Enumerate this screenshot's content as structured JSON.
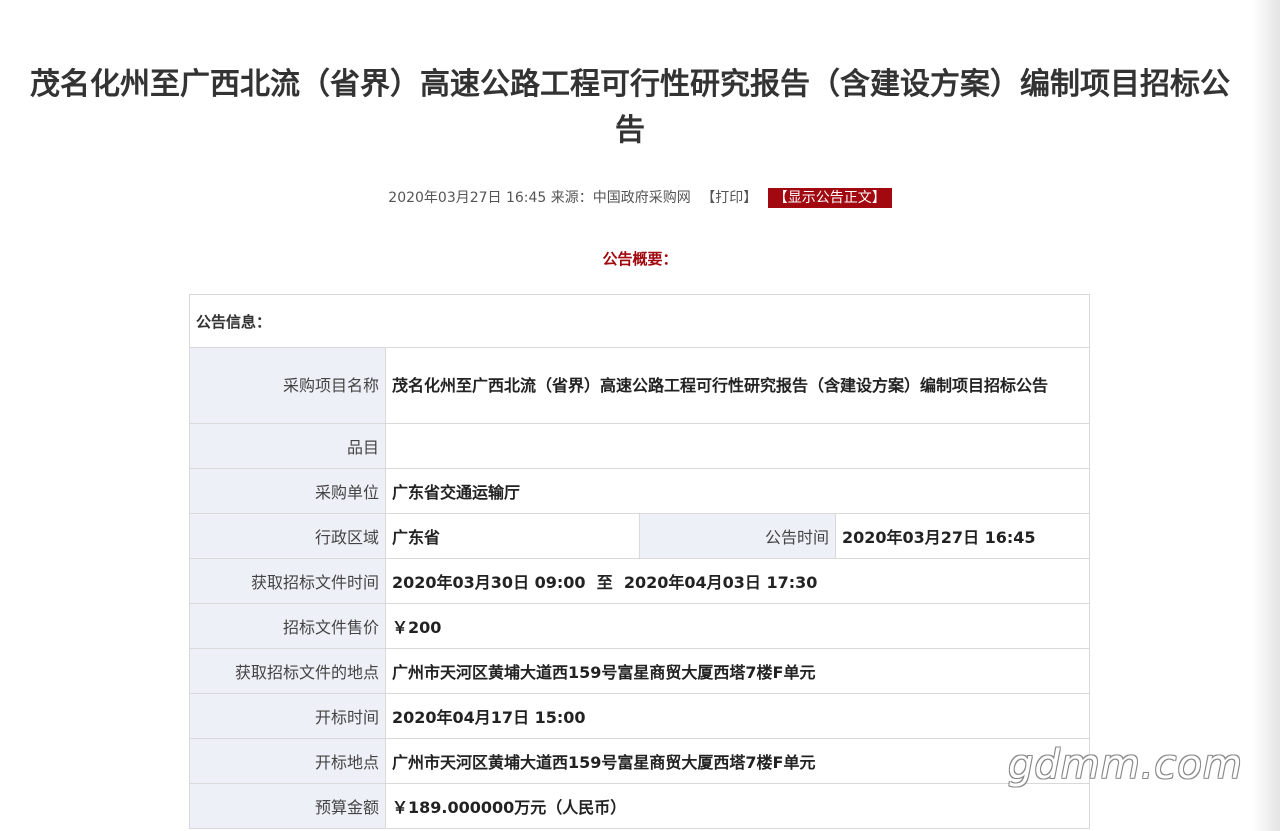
{
  "title": "茂名化州至广西北流（省界）高速公路工程可行性研究报告（含建设方案）编制项目招标公告",
  "meta": {
    "datetime": "2020年03月27日 16:45",
    "source_label": "来源：",
    "source": "中国政府采购网",
    "print": "【打印】",
    "show_text": "【显示公告正文】"
  },
  "summary_title": "公告概要：",
  "table": {
    "header": "公告信息：",
    "project_name_label": "采购项目名称",
    "project_name": "茂名化州至广西北流（省界）高速公路工程可行性研究报告（含建设方案）编制项目招标公告",
    "category_label": "品目",
    "category": "",
    "buyer_label": "采购单位",
    "buyer": "广东省交通运输厅",
    "region_label": "行政区域",
    "region": "广东省",
    "notice_time_label": "公告时间",
    "notice_time": "2020年03月27日 16:45",
    "doc_time_label": "获取招标文件时间",
    "doc_time": "2020年03月30日 09:00  至  2020年04月03日 17:30",
    "doc_price_label": "招标文件售价",
    "doc_price": "￥200",
    "doc_place_label": "获取招标文件的地点",
    "doc_place": "广州市天河区黄埔大道西159号富星商贸大厦西塔7楼F单元",
    "open_time_label": "开标时间",
    "open_time": "2020年04月17日 15:00",
    "open_place_label": "开标地点",
    "open_place": "广州市天河区黄埔大道西159号富星商贸大厦西塔7楼F单元",
    "budget_label": "预算金额",
    "budget": "￥189.000000万元（人民币）"
  },
  "watermark": "gdmm.com"
}
